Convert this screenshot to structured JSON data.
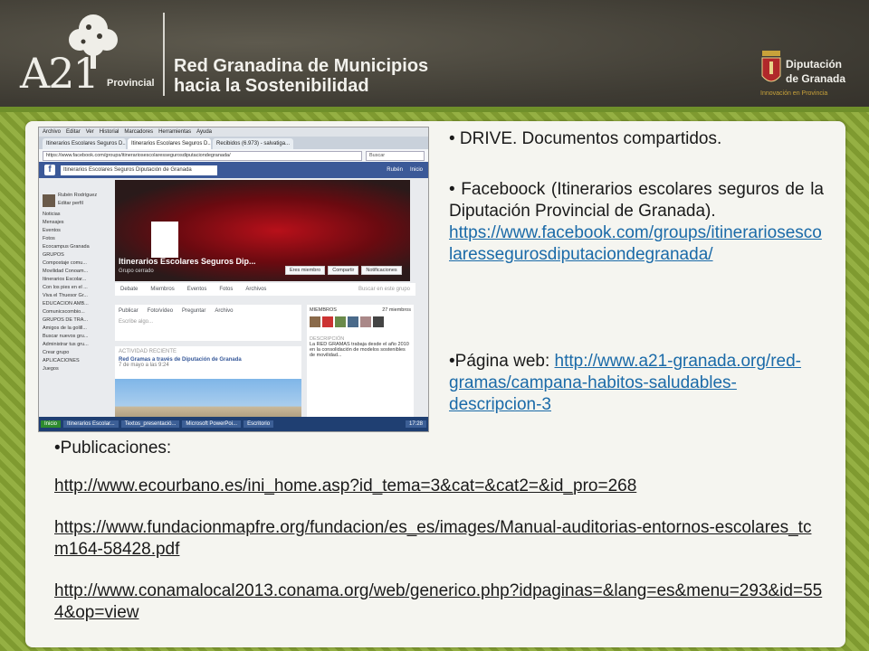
{
  "header": {
    "logo_text": "A21",
    "logo_sub": "Provincial",
    "title_line1": "Red Granadina de Municipios",
    "title_line2": "hacia la Sostenibilidad",
    "dip_line1": "Diputación",
    "dip_line2": "de Granada",
    "dip_small": "Innovación en Provincia"
  },
  "screenshot": {
    "menu": [
      "Archivo",
      "Editar",
      "Ver",
      "Historial",
      "Marcadores",
      "Herramientas",
      "Ayuda"
    ],
    "tabs": [
      "Itinerarios Escolares Seguros D...",
      "Itinerarios Escolares Seguros D...",
      "Recibidos (6.973) - salvatiga..."
    ],
    "url": "https://www.facebook.com/groups/itinerariosescolaressegurosdiputaciondegranada/",
    "browser_search": "Buscar",
    "fb_search": "Itinerarios Escolares Seguros Diputación de Granada",
    "fb_user": "Rubén",
    "fb_home": "Inicio",
    "profile_name": "Rubén Rodríguez",
    "profile_edit": "Editar perfil",
    "left_items": [
      "Noticias",
      "Mensajes",
      "Eventos",
      "Fotos",
      "Ecocampus Granada",
      "GRUPOS",
      "Compostaje comu...",
      "Movilidad Conoam...",
      "Itinerarios Escolar...",
      "Con los pies en el ...",
      "Viva el Thuesor Gr...",
      "EDUCACIÓN AMB...",
      "Comunicscombio...",
      "GRUPOS DE TRA...",
      "Amigos de la golill...",
      "Buscar nuevos gru...",
      "Administrar tus gru...",
      "Crear grupo",
      "APLICACIONES",
      "Juegos"
    ],
    "group_title": "Itinerarios Escolares Seguros Dip...",
    "group_sub": "Grupo cerrado",
    "cover_buttons": [
      "Eres miembro",
      "Compartir",
      "Notificaciones"
    ],
    "group_tabs": [
      "Debate",
      "Miembros",
      "Eventos",
      "Fotos",
      "Archivos"
    ],
    "group_search": "Buscar en este grupo",
    "post_tabs": [
      "Publicar",
      "Foto/vídeo",
      "Preguntar",
      "Archivo"
    ],
    "post_placeholder": "Escribe algo...",
    "feed_header": "ACTIVIDAD RECIENTE",
    "feed_author": "Red Gramas a través de Diputación de Granada",
    "feed_date": "7 de mayo a las 9:24",
    "members_label": "MIEMBROS",
    "members_count": "27 miembros",
    "right_desc_label": "DESCRIPCIÓN",
    "right_desc": "La RED GRAMAS trabaja desde el año 2010 en la consolidación de modelos sostenibles de movilidad...",
    "taskbar": [
      "Inicio",
      "Itinerarios Escolar...",
      "Textos_presentació...",
      "Microsoft PowerPoi...",
      "Escritorio"
    ],
    "clock": "17:28"
  },
  "right_text": {
    "item1": "• DRIVE. Documentos compartidos.",
    "item2_text": "• Faceboock (Itinerarios escolares seguros de la Diputación Provincial de Granada).",
    "item2_link": "https://www.facebook.com/groups/itinerariosescolaressegurosdiputaciondegranada/",
    "item3_prefix": "•Página web: ",
    "item3_link": "http://www.a21-granada.org/red-gramas/campana-habitos-saludables-descripcion-3"
  },
  "publicaciones": {
    "label": "•Publicaciones:",
    "link1": "http://www.ecourbano.es/ini_home.asp?id_tema=3&cat=&cat2=&id_pro=268",
    "link2": "https://www.fundacionmapfre.org/fundacion/es_es/images/Manual-auditorias-entornos-escolares_tcm164-58428.pdf",
    "link3": "http://www.conamalocal2013.conama.org/web/generico.php?idpaginas=&lang=es&menu=293&id=554&op=view"
  },
  "colors": {
    "header_bg": "#3e3b33",
    "green_bg": "#8aa63a",
    "link": "#1a6aa8",
    "facebook_blue": "#3b5998"
  }
}
